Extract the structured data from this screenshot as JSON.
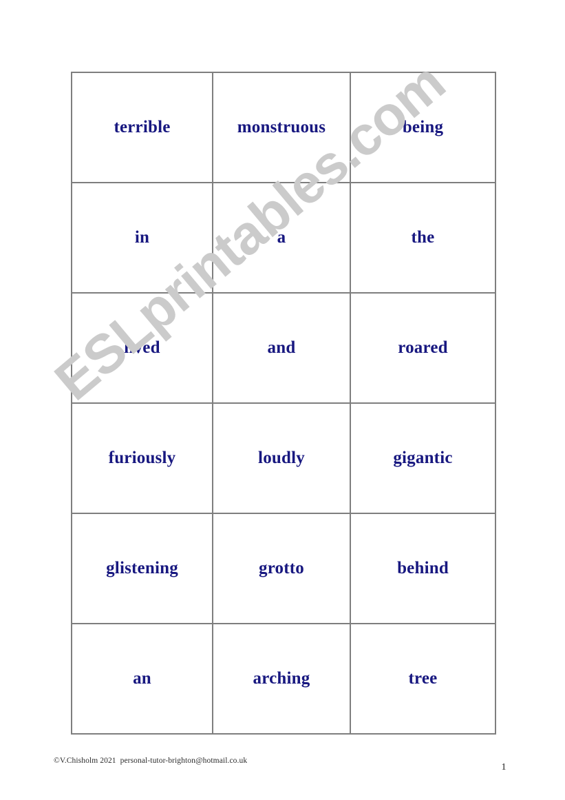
{
  "document": {
    "type": "word-card-worksheet",
    "page_number": "1",
    "watermark": "ESLprintables.com",
    "footer_credit": "©V.Chisholm 2021  personal-tutor-brighton@hotmail.co.uk"
  },
  "colors": {
    "word_text": "#181880",
    "table_border": "#7e7e7e",
    "watermark": "#cbcbcb",
    "page_background": "#ffffff",
    "footer_text": "#2b2b2b"
  },
  "word_table": {
    "columns": 3,
    "rows": 6,
    "cells": [
      [
        "terrible",
        "monstruous",
        "being"
      ],
      [
        "in",
        "a",
        "the"
      ],
      [
        "lived",
        "and",
        "roared"
      ],
      [
        "furiously",
        "loudly",
        "gigantic"
      ],
      [
        "glistening",
        "grotto",
        "behind"
      ],
      [
        "an",
        "arching",
        "tree"
      ]
    ]
  }
}
